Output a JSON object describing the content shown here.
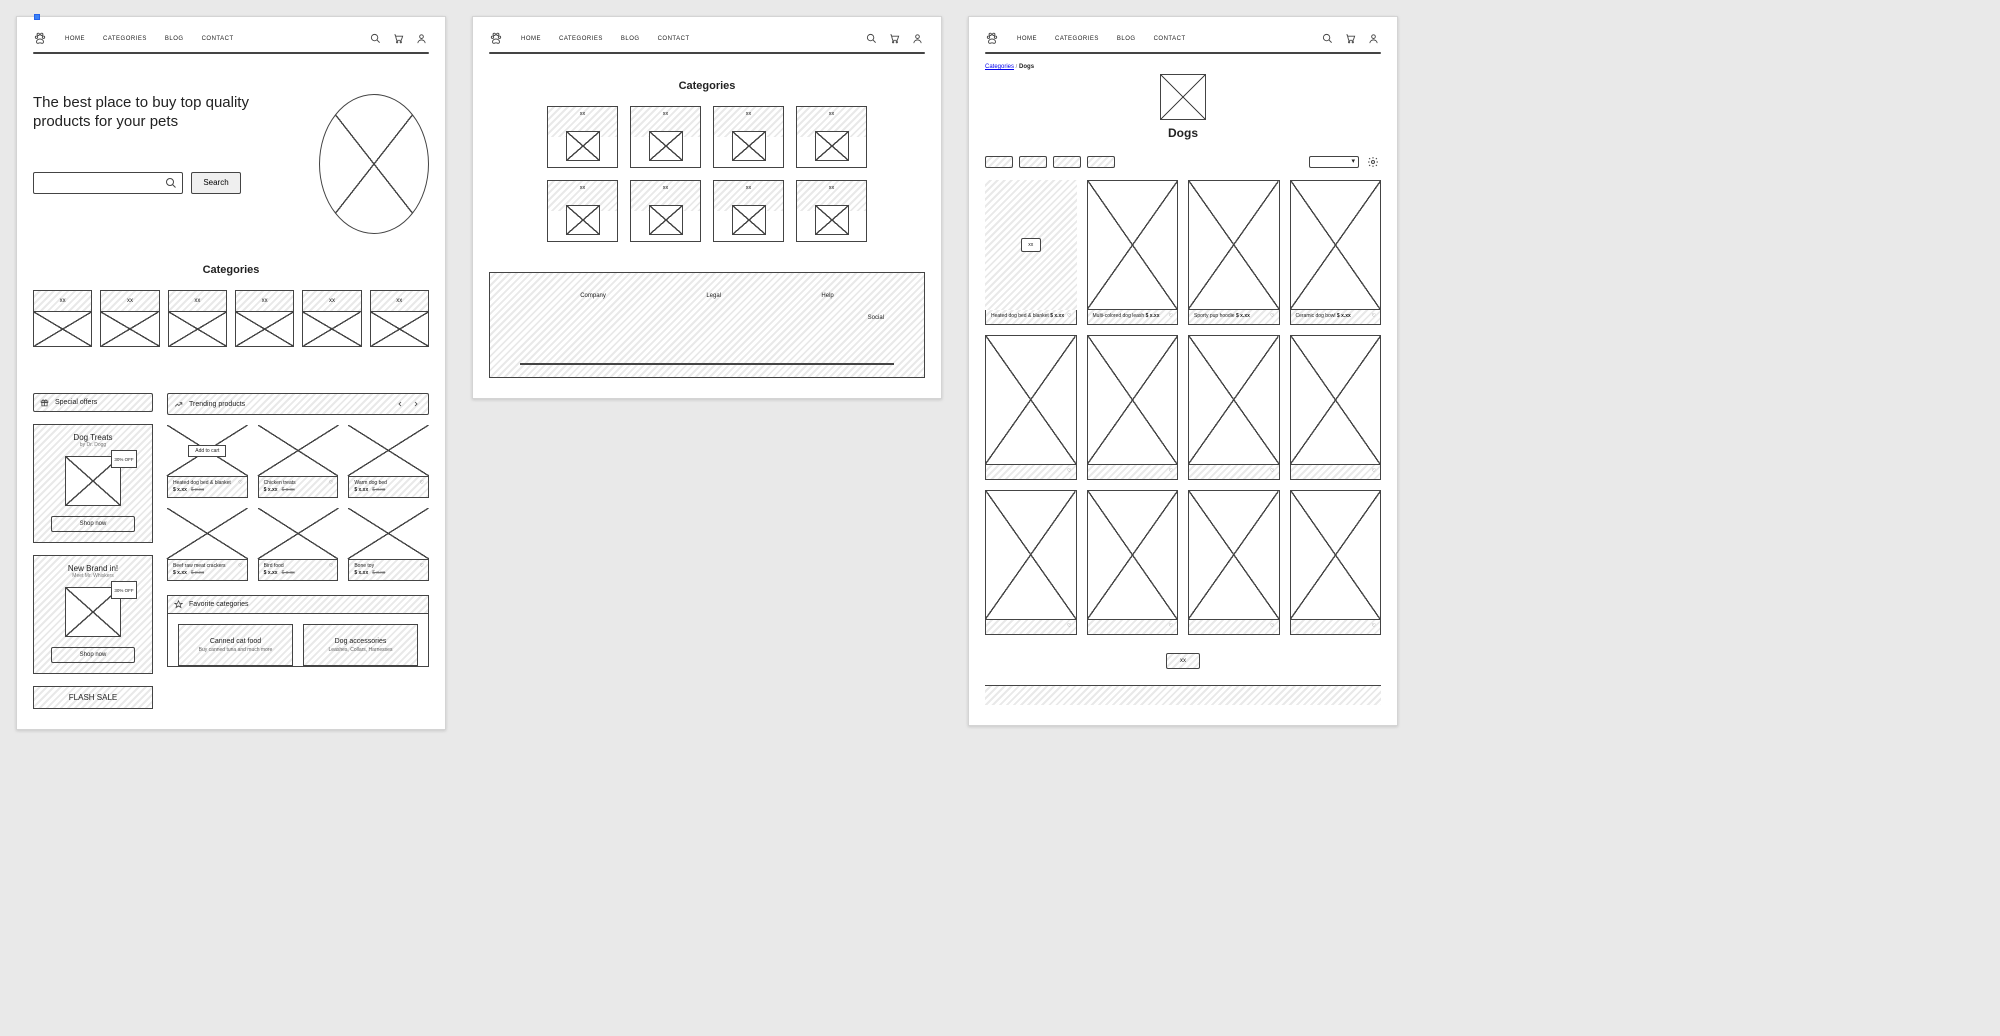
{
  "nav": {
    "home": "HOME",
    "categories": "CATEGORIES",
    "blog": "BLOG",
    "contact": "CONTACT"
  },
  "home": {
    "hero_heading": "The best place to buy top quality products for your pets",
    "search_placeholder": "",
    "search_btn": "Search",
    "categories_heading": "Categories",
    "category_tiles": [
      "xx",
      "xx",
      "xx",
      "xx",
      "xx",
      "xx"
    ],
    "offers_heading": "Special offers",
    "offers": [
      {
        "title": "Dog Treats",
        "subtitle": "by Dr. Dogg",
        "badge": "30% OFF",
        "cta": "Shop now"
      },
      {
        "title": "New Brand in!",
        "subtitle": "Meet Mr. Whiskers",
        "badge": "30% OFF",
        "cta": "Shop now"
      },
      {
        "title": "FLASH SALE"
      }
    ],
    "trending_heading": "Trending products",
    "add_to_cart": "Add to cart",
    "products": [
      {
        "name": "Heated dog bed & blanket",
        "price": "$ x.xx",
        "old": "$ x.xx"
      },
      {
        "name": "Chicken treats",
        "price": "$ x.xx",
        "old": "$ x.xx"
      },
      {
        "name": "Warm dog bed",
        "price": "$ x.xx",
        "old": "$ x.xx"
      },
      {
        "name": "Beef raw meat crackers",
        "price": "$ x.xx",
        "old": "$ x.xx"
      },
      {
        "name": "Bird food",
        "price": "$ x.xx",
        "old": "$ x.xx"
      },
      {
        "name": "Bone toy",
        "price": "$ x.xx",
        "old": "$ x.xx"
      }
    ],
    "favcats_heading": "Favorite categories",
    "favcats": [
      {
        "big": "Canned cat food",
        "small": "Buy canned tuna and much more"
      },
      {
        "big": "Dog accessories",
        "small": "Leashes, Collars, Harnesses"
      }
    ]
  },
  "catpage": {
    "heading": "Categories",
    "tiles": [
      "xx",
      "xx",
      "xx",
      "xx",
      "xx",
      "xx",
      "xx",
      "xx"
    ],
    "footer": {
      "company": "Company",
      "legal": "Legal",
      "help": "Help",
      "social": "Social"
    }
  },
  "listing": {
    "breadcrumb_root": "Categories",
    "breadcrumb_sep": " / ",
    "breadcrumb_leaf": "Dogs",
    "page_title": "Dogs",
    "filter_chips": [
      "",
      "",
      "",
      ""
    ],
    "sort_label": "",
    "xx_button": "xx",
    "products": [
      {
        "name": "Heated dog bed & blanket",
        "price": "$ x.xx"
      },
      {
        "name": "Multi-colored dog leash",
        "price": "$ x.xx"
      },
      {
        "name": "Sporty pup hoodie",
        "price": "$ x.xx"
      },
      {
        "name": "Ceramic dog bowl",
        "price": "$ x.xx"
      }
    ],
    "blank_row_count": 8,
    "load_more": "xx"
  }
}
